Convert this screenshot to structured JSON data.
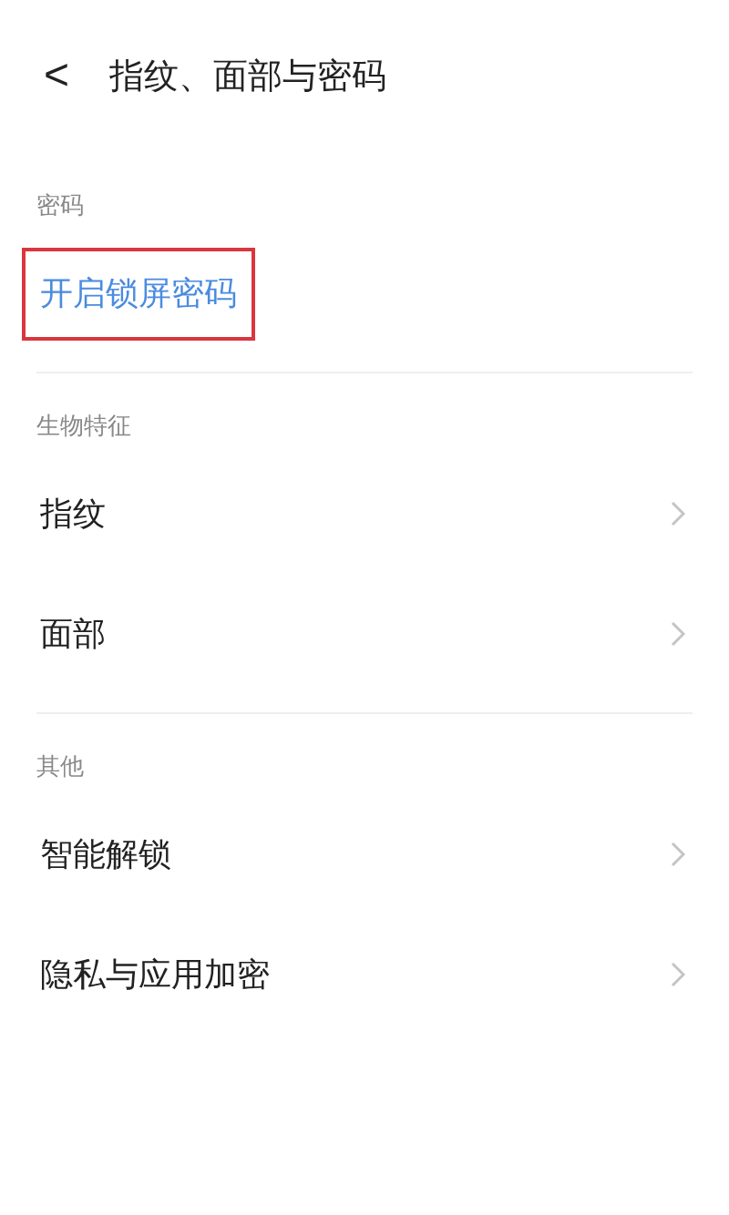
{
  "header": {
    "back": "<",
    "title": "指纹、面部与密码"
  },
  "sections": [
    {
      "label": "密码",
      "items": [
        {
          "text": "开启锁屏密码",
          "kind": "link",
          "highlighted": true
        }
      ]
    },
    {
      "label": "生物特征",
      "items": [
        {
          "text": "指纹",
          "kind": "nav",
          "highlighted": false
        },
        {
          "text": "面部",
          "kind": "nav",
          "highlighted": false
        }
      ]
    },
    {
      "label": "其他",
      "items": [
        {
          "text": "智能解锁",
          "kind": "nav",
          "highlighted": false
        },
        {
          "text": "隐私与应用加密",
          "kind": "nav",
          "highlighted": false
        }
      ]
    }
  ]
}
